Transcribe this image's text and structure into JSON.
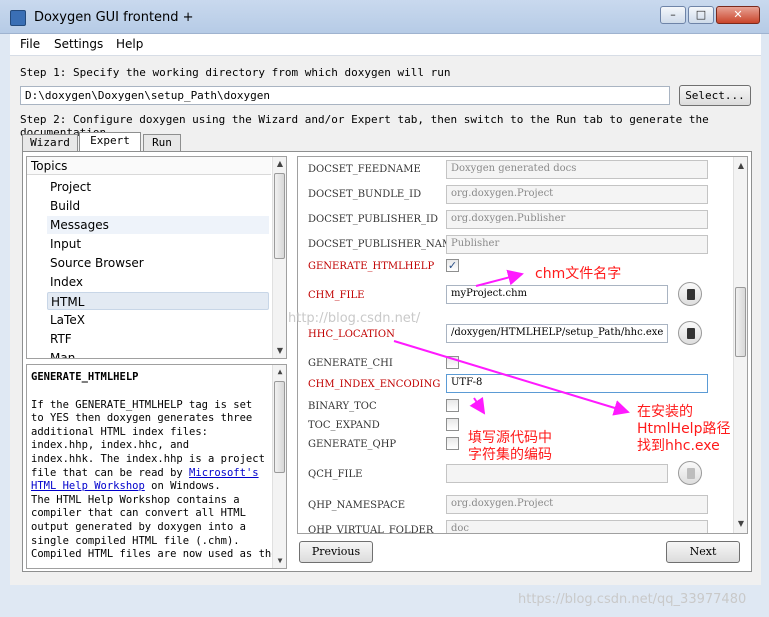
{
  "window": {
    "title": "Doxygen GUI frontend +",
    "min": "–",
    "max": "□",
    "close": "✕"
  },
  "menu": {
    "file": "File",
    "settings": "Settings",
    "help": "Help"
  },
  "step1": {
    "label": "Step 1: Specify the working directory from which doxygen will run",
    "path": "D:\\doxygen\\Doxygen\\setup_Path\\doxygen",
    "select": "Select..."
  },
  "step2": {
    "label": "Step 2: Configure doxygen using the Wizard and/or Expert tab, then switch to the Run tab to generate the documentation"
  },
  "tabs": {
    "wizard": "Wizard",
    "expert": "Expert",
    "run": "Run"
  },
  "topics": {
    "header": "Topics",
    "items": [
      "Project",
      "Build",
      "Messages",
      "Input",
      "Source Browser",
      "Index",
      "HTML",
      "LaTeX",
      "RTF",
      "Man"
    ]
  },
  "help": {
    "title": "GENERATE_HTMLHELP",
    "lines": [
      "If the GENERATE_HTMLHELP tag is set",
      "to YES then doxygen generates three",
      "additional HTML index files:",
      "index.hhp, index.hhc, and",
      "index.hhk. The index.hhp is a project",
      "file that can be read by",
      "Microsoft's",
      "HTML Help Workshop",
      "on Windows.",
      "The HTML Help Workshop contains a",
      "compiler that can convert all HTML",
      "output generated by doxygen into a",
      "single compiled HTML file (.chm).",
      "Compiled HTML files are now used as the"
    ]
  },
  "options": {
    "docset_feedname": {
      "label": "DOCSET_FEEDNAME",
      "value": "Doxygen generated docs"
    },
    "docset_bundle_id": {
      "label": "DOCSET_BUNDLE_ID",
      "value": "org.doxygen.Project"
    },
    "docset_publisher_id": {
      "label": "DOCSET_PUBLISHER_ID",
      "value": "org.doxygen.Publisher"
    },
    "docset_publisher_name": {
      "label": "DOCSET_PUBLISHER_NAME",
      "value": "Publisher"
    },
    "generate_htmlhelp": {
      "label": "GENERATE_HTMLHELP",
      "check": "✓"
    },
    "chm_file": {
      "label": "CHM_FILE",
      "value": "myProject.chm"
    },
    "hhc_location": {
      "label": "HHC_LOCATION",
      "value": "/doxygen/HTMLHELP/setup_Path/hhc.exe"
    },
    "generate_chi": {
      "label": "GENERATE_CHI"
    },
    "chm_index_encoding": {
      "label": "CHM_INDEX_ENCODING",
      "value": "UTF-8"
    },
    "binary_toc": {
      "label": "BINARY_TOC"
    },
    "toc_expand": {
      "label": "TOC_EXPAND"
    },
    "generate_qhp": {
      "label": "GENERATE_QHP"
    },
    "qch_file": {
      "label": "QCH_FILE",
      "value": ""
    },
    "qhp_namespace": {
      "label": "QHP_NAMESPACE",
      "value": "org.doxygen.Project"
    },
    "qhp_virtual_folder": {
      "label": "QHP_VIRTUAL_FOLDER",
      "value": "doc"
    }
  },
  "nav": {
    "previous": "Previous",
    "next": "Next"
  },
  "annotations": {
    "chm_name": "chm文件名字",
    "encoding": [
      "填写源代码中",
      "字符集的编码"
    ],
    "htmlhelp": [
      "在安装的",
      "HtmlHelp路径",
      "找到hhc.exe"
    ]
  },
  "watermarks": {
    "mid": "http://blog.csdn.net/",
    "bottom": "https://blog.csdn.net/qq_33977480"
  },
  "colors": {
    "annotation": "#ff1a1a",
    "required_label": "#c00000",
    "link": "#0000cc"
  }
}
